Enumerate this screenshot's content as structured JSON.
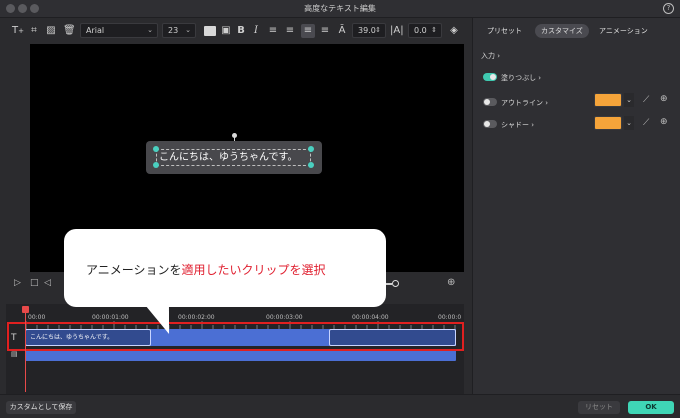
{
  "window": {
    "title": "高度なテキスト編集",
    "help_icon": "?"
  },
  "toolbar": {
    "text_tool_icon": "T",
    "font": "Arial",
    "font_size": "23",
    "bold": "B",
    "italic": "I",
    "line_spacing": "39.0",
    "char_spacing": "0.0"
  },
  "canvas": {
    "text": "こんにちは、ゆうちゃんです。"
  },
  "timeline": {
    "ruler_labels": [
      "00:00",
      "00:00:01:00",
      "00:00:02:00",
      "00:00:03:00",
      "00:00:04:00",
      "00:00:0"
    ],
    "clip_text": "こんにちは、ゆうちゃんです。",
    "text_track_icon": "T"
  },
  "callout": {
    "prefix": "アニメーションを",
    "highlight": "適用したいクリップを選択"
  },
  "panel": {
    "tabs": [
      "プリセット",
      "カスタマイズ",
      "アニメーション"
    ],
    "active_tab": "カスタマイズ",
    "input_label": "入力",
    "fill_label": "塗りつぶし",
    "outline_label": "アウトライン",
    "shadow_label": "シャドー",
    "swatch_color": "#f5a43a",
    "accent_color": "#3fc9b0"
  },
  "bottom": {
    "save_custom": "カスタムとして保存",
    "reset": "リセット",
    "ok": "OK"
  }
}
